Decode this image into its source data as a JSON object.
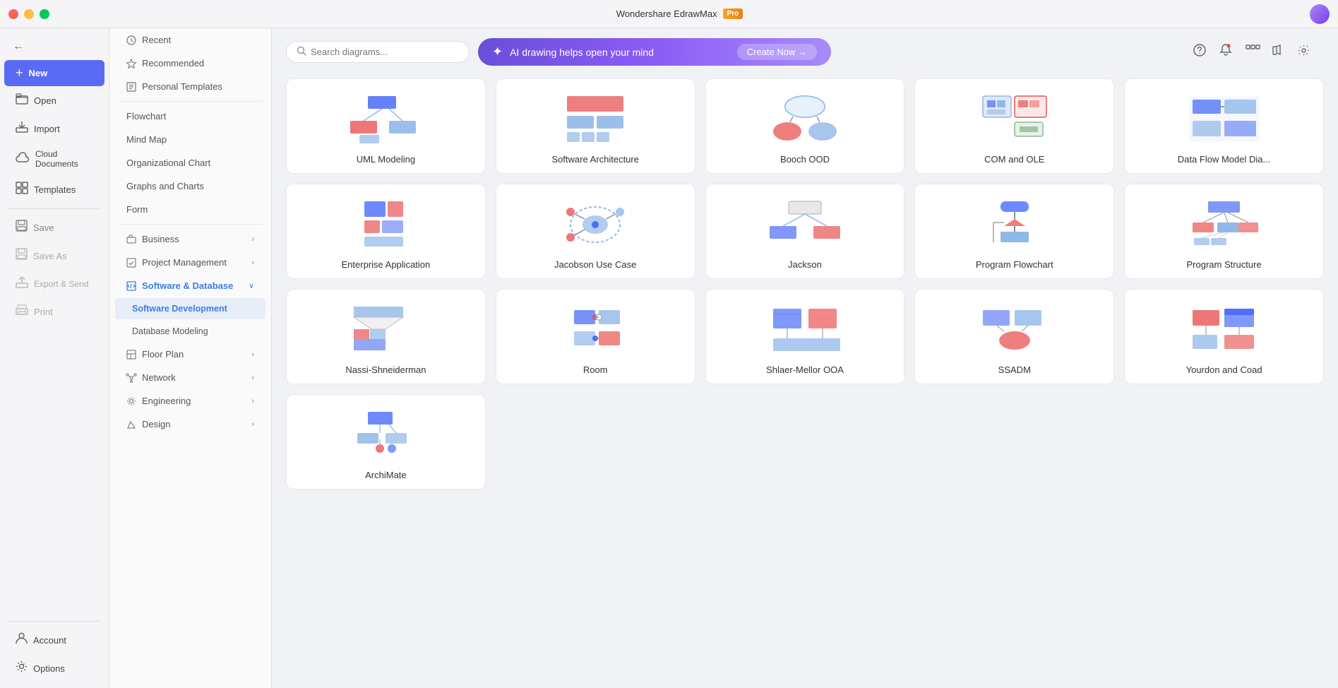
{
  "titleBar": {
    "appName": "Wondershare EdrawMax",
    "proBadge": "Pro",
    "winButtons": {
      "minimize": "—",
      "maximize": "⬜",
      "close": "✕"
    }
  },
  "sidebar": {
    "items": [
      {
        "id": "back",
        "icon": "←",
        "label": ""
      },
      {
        "id": "new",
        "icon": "+",
        "label": "New"
      },
      {
        "id": "open",
        "icon": "📂",
        "label": "Open"
      },
      {
        "id": "import",
        "icon": "📥",
        "label": "Import"
      },
      {
        "id": "cloud",
        "icon": "☁",
        "label": "Cloud Documents"
      },
      {
        "id": "templates",
        "icon": "⊞",
        "label": "Templates"
      },
      {
        "id": "save",
        "icon": "💾",
        "label": "Save"
      },
      {
        "id": "saveas",
        "icon": "💾",
        "label": "Save As"
      },
      {
        "id": "export",
        "icon": "📤",
        "label": "Export & Send"
      },
      {
        "id": "print",
        "icon": "🖨",
        "label": "Print"
      },
      {
        "id": "account",
        "icon": "👤",
        "label": "Account"
      },
      {
        "id": "options",
        "icon": "⚙",
        "label": "Options"
      }
    ]
  },
  "templatePanel": {
    "sections": [
      {
        "type": "item",
        "label": "Recent",
        "id": "recent"
      },
      {
        "type": "item",
        "label": "Recommended",
        "id": "recommended"
      },
      {
        "type": "item",
        "label": "Personal Templates",
        "id": "personal"
      },
      {
        "type": "divider"
      },
      {
        "type": "item",
        "label": "Flowchart",
        "id": "flowchart"
      },
      {
        "type": "item",
        "label": "Mind Map",
        "id": "mindmap"
      },
      {
        "type": "item",
        "label": "Organizational Chart",
        "id": "orgchart"
      },
      {
        "type": "item",
        "label": "Graphs and Charts",
        "id": "graphs"
      },
      {
        "type": "item",
        "label": "Form",
        "id": "form"
      },
      {
        "type": "group",
        "label": "Business",
        "id": "business",
        "hasArrow": true
      },
      {
        "type": "group",
        "label": "Project Management",
        "id": "project",
        "hasArrow": true
      },
      {
        "type": "group",
        "label": "Software & Database",
        "id": "software",
        "hasArrow": true,
        "active": true
      },
      {
        "type": "subitem",
        "label": "Software Development",
        "id": "swdev",
        "active": true
      },
      {
        "type": "subitem",
        "label": "Database Modeling",
        "id": "dbmodel"
      },
      {
        "type": "group",
        "label": "Floor Plan",
        "id": "floorplan",
        "hasArrow": true
      },
      {
        "type": "group",
        "label": "Network",
        "id": "network",
        "hasArrow": true
      },
      {
        "type": "group",
        "label": "Engineering",
        "id": "engineering",
        "hasArrow": true
      },
      {
        "type": "group",
        "label": "Design",
        "id": "design",
        "hasArrow": true
      }
    ]
  },
  "search": {
    "placeholder": "Search diagrams..."
  },
  "aiBanner": {
    "text": "AI drawing helps open your mind",
    "buttonLabel": "Create Now →",
    "icon": "✦"
  },
  "cards": [
    {
      "id": "uml",
      "label": "UML Modeling",
      "type": "uml"
    },
    {
      "id": "software-arch",
      "label": "Software Architecture",
      "type": "software-arch"
    },
    {
      "id": "booch",
      "label": "Booch OOD",
      "type": "booch"
    },
    {
      "id": "com",
      "label": "COM and OLE",
      "type": "com"
    },
    {
      "id": "dataflow",
      "label": "Data Flow Model Dia...",
      "type": "dataflow"
    },
    {
      "id": "enterprise",
      "label": "Enterprise Application",
      "type": "enterprise"
    },
    {
      "id": "jacobson",
      "label": "Jacobson Use Case",
      "type": "jacobson"
    },
    {
      "id": "jackson",
      "label": "Jackson",
      "type": "jackson"
    },
    {
      "id": "program-flow",
      "label": "Program Flowchart",
      "type": "program-flow"
    },
    {
      "id": "program-struct",
      "label": "Program Structure",
      "type": "program-struct"
    },
    {
      "id": "nassi",
      "label": "Nassi-Shneiderman",
      "type": "nassi"
    },
    {
      "id": "room",
      "label": "Room",
      "type": "room"
    },
    {
      "id": "shlaer",
      "label": "Shlaer-Mellor OOA",
      "type": "shlaer"
    },
    {
      "id": "ssadm",
      "label": "SSADM",
      "type": "ssadm"
    },
    {
      "id": "yourdon",
      "label": "Yourdon and Coad",
      "type": "yourdon"
    },
    {
      "id": "archimate",
      "label": "ArchiMate",
      "type": "archimate"
    }
  ],
  "colors": {
    "blue": "#3b7de8",
    "red": "#e8453c",
    "lightblue": "#90b8e8",
    "accent": "#5b6af5"
  }
}
